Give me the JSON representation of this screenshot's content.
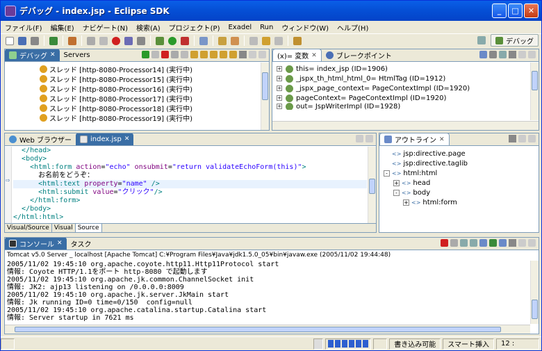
{
  "window": {
    "title": "デバッグ - index.jsp - Eclipse SDK",
    "minimize": "_",
    "maximize": "□",
    "close": "✕"
  },
  "menu": [
    "ファイル(F)",
    "編集(E)",
    "ナビゲート(N)",
    "検索(A)",
    "プロジェクト(P)",
    "Exadel",
    "Run",
    "ウィンドウ(W)",
    "ヘルプ(H)"
  ],
  "perspective": {
    "label": "デバッグ"
  },
  "debug_view": {
    "tabs": [
      {
        "label": "デバッグ"
      },
      {
        "label": "Servers"
      }
    ],
    "rows": [
      "スレッド [http-8080-Processor14] (実行中)",
      "スレッド [http-8080-Processor15] (実行中)",
      "スレッド [http-8080-Processor16] (実行中)",
      "スレッド [http-8080-Processor17] (実行中)",
      "スレッド [http-8080-Processor18] (実行中)",
      "スレッド [http-8080-Processor19] (実行中)"
    ]
  },
  "variables_view": {
    "tabs": [
      {
        "label": "(x)= 変数"
      },
      {
        "label": "ブレークポイント"
      }
    ],
    "rows": [
      "this= index_jsp  (ID=1906)",
      "_jspx_th_html_html_0= HtmlTag  (ID=1912)",
      "_jspx_page_context= PageContextImpl  (ID=1920)",
      "pageContext= PageContextImpl  (ID=1920)",
      "out= JspWriterImpl  (ID=1928)"
    ]
  },
  "editor": {
    "tabs": [
      {
        "label": "Web ブラウザー"
      },
      {
        "label": "index.jsp"
      }
    ],
    "lines": [
      {
        "indent": "  ",
        "parts": [
          {
            "c": "tag",
            "t": "</head>"
          }
        ]
      },
      {
        "indent": "  ",
        "parts": [
          {
            "c": "tag",
            "t": "<body>"
          }
        ]
      },
      {
        "indent": "    ",
        "parts": [
          {
            "c": "tag",
            "t": "<html:form "
          },
          {
            "c": "attr",
            "t": "action"
          },
          {
            "c": "",
            "t": "="
          },
          {
            "c": "val",
            "t": "\"echo\""
          },
          {
            "c": "",
            "t": " "
          },
          {
            "c": "attr",
            "t": "onsubmit"
          },
          {
            "c": "",
            "t": "="
          },
          {
            "c": "val",
            "t": "\"return validateEchoForm(this)\""
          },
          {
            "c": "tag",
            "t": ">"
          }
        ]
      },
      {
        "indent": "      ",
        "parts": [
          {
            "c": "",
            "t": "お名前をどうぞ："
          }
        ]
      },
      {
        "indent": "      ",
        "parts": [
          {
            "c": "tag",
            "t": "<html:text "
          },
          {
            "c": "attr",
            "t": "property"
          },
          {
            "c": "",
            "t": "="
          },
          {
            "c": "val",
            "t": "\"name\""
          },
          {
            "c": "tag",
            "t": " />"
          }
        ]
      },
      {
        "indent": "      ",
        "parts": [
          {
            "c": "tag",
            "t": "<html:submit "
          },
          {
            "c": "attr",
            "t": "value"
          },
          {
            "c": "",
            "t": "="
          },
          {
            "c": "val",
            "t": "\"クリック\""
          },
          {
            "c": "tag",
            "t": "/>"
          }
        ]
      },
      {
        "indent": "    ",
        "parts": [
          {
            "c": "tag",
            "t": "</html:form>"
          }
        ]
      },
      {
        "indent": "  ",
        "parts": [
          {
            "c": "tag",
            "t": "</body>"
          }
        ]
      },
      {
        "indent": "",
        "parts": [
          {
            "c": "tag",
            "t": "</html:html>"
          }
        ]
      }
    ],
    "bottom_tabs": [
      "Visual/Source",
      "Visual",
      "Source"
    ]
  },
  "outline_view": {
    "tab": "アウトライン",
    "items": [
      {
        "label": "jsp:directive.page",
        "depth": 0,
        "toggle": ""
      },
      {
        "label": "jsp:directive.taglib",
        "depth": 0,
        "toggle": ""
      },
      {
        "label": "html:html",
        "depth": 0,
        "toggle": "-"
      },
      {
        "label": "head",
        "depth": 1,
        "toggle": "+"
      },
      {
        "label": "body",
        "depth": 1,
        "toggle": "-"
      },
      {
        "label": "html:form",
        "depth": 2,
        "toggle": "+"
      }
    ]
  },
  "console_view": {
    "tabs": [
      {
        "label": "コンソール"
      },
      {
        "label": "タスク"
      }
    ],
    "header": "Tomcat v5.0 Server _ localhost [Apache Tomcat] C:¥Program Files¥Java¥jdk1.5.0_05¥bin¥javaw.exe (2005/11/02 19:44:48)",
    "lines": [
      "2005/11/02 19:45:10 org.apache.coyote.http11.Http11Protocol start",
      "情報: Coyote HTTP/1.1をポート http-8080 で起動します",
      "2005/11/02 19:45:10 org.apache.jk.common.ChannelSocket init",
      "情報: JK2: ajp13 listening on /0.0.0.0:8009",
      "2005/11/02 19:45:10 org.apache.jk.server.JkMain start",
      "情報: Jk running ID=0 time=0/150  config=null",
      "2005/11/02 19:45:10 org.apache.catalina.startup.Catalina start",
      "情報: Server startup in 7621 ms"
    ]
  },
  "status": {
    "writable": "書き込み可能",
    "insert_mode": "スマート挿入",
    "position": "12 :"
  }
}
